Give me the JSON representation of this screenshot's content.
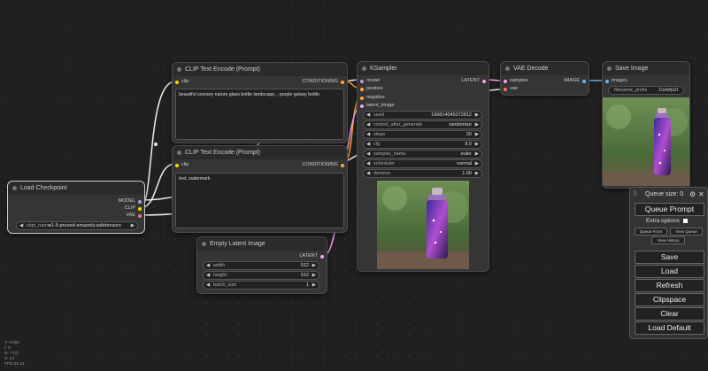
{
  "nodes": {
    "clip_pos": {
      "title": "CLIP Text Encode (Prompt)",
      "input": "clip",
      "output": "CONDITIONING",
      "text": "beautiful scenery nature glass bottle landscape, , purple galaxy bottle,"
    },
    "clip_neg": {
      "title": "CLIP Text Encode (Prompt)",
      "input": "clip",
      "output": "CONDITIONING",
      "text": "text, watermark"
    },
    "checkpoint": {
      "title": "Load Checkpoint",
      "outputs": [
        "MODEL",
        "CLIP",
        "VAE"
      ],
      "ckpt_label": "ckpt_name",
      "ckpt_value": "v1-5-pruned-emaonly.safetensors"
    },
    "latent": {
      "title": "Empty Latent Image",
      "output": "LATENT",
      "widgets": [
        {
          "label": "width",
          "value": "512"
        },
        {
          "label": "height",
          "value": "512"
        },
        {
          "label": "batch_size",
          "value": "1"
        }
      ]
    },
    "ksampler": {
      "title": "KSampler",
      "inputs": [
        "model",
        "positive",
        "negative",
        "latent_image"
      ],
      "output": "LATENT",
      "widgets": [
        {
          "label": "seed",
          "value": "196814045372812"
        },
        {
          "label": "control_after_generate",
          "value": "randomize"
        },
        {
          "label": "steps",
          "value": "20"
        },
        {
          "label": "cfg",
          "value": "8.0"
        },
        {
          "label": "sampler_name",
          "value": "euler"
        },
        {
          "label": "scheduler",
          "value": "normal"
        },
        {
          "label": "denoise",
          "value": "1.00"
        }
      ]
    },
    "vae": {
      "title": "VAE Decode",
      "inputs": [
        "samples",
        "vae"
      ],
      "output": "IMAGE"
    },
    "save": {
      "title": "Save Image",
      "input": "images",
      "prefix_label": "filename_prefix",
      "prefix_value": "ComfyUI"
    }
  },
  "menu": {
    "queue_size": "Queue size: 0",
    "queue_prompt": "Queue Prompt",
    "extra_options": "Extra options",
    "queue_front": "Queue Front",
    "view_queue": "View Queue",
    "view_history": "View History",
    "buttons": [
      "Save",
      "Load",
      "Refresh",
      "Clipspace",
      "Clear",
      "Load Default"
    ]
  },
  "stats": [
    "T: 0.00s",
    "I: 0",
    "N: 7 [7]",
    "V: 14",
    "FPS:29.41"
  ],
  "colors": {
    "model": "#b39ddb",
    "clip": "#ffd500",
    "vae": "#ff6e6e",
    "conditioning": "#ffa931",
    "latent": "#ff9cf9",
    "image": "#64b5f6"
  }
}
